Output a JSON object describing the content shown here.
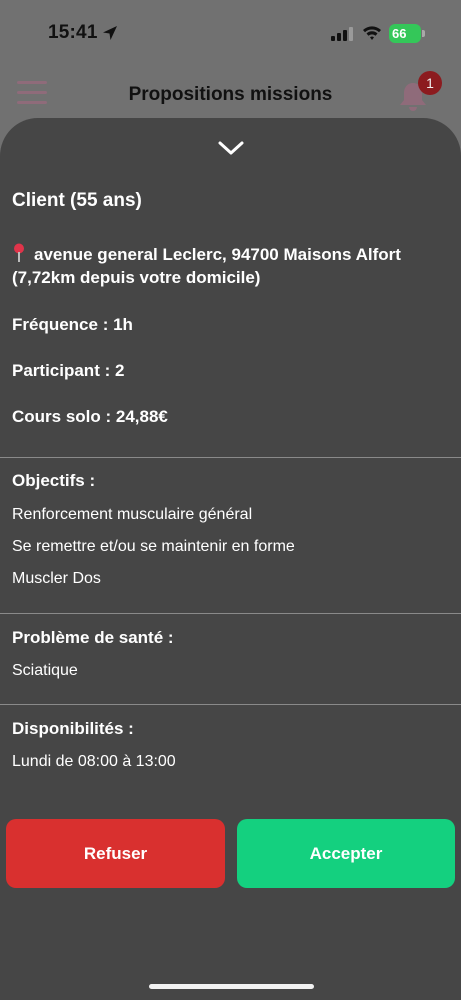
{
  "status_bar": {
    "time": "15:41",
    "battery": "66",
    "battery_color": "#34c759"
  },
  "header": {
    "title": "Propositions missions",
    "notification_count": "1",
    "icons": [
      "menu-icon",
      "bell-icon"
    ]
  },
  "sheet": {
    "client": "Client (55 ans)",
    "address_line1": "avenue general Leclerc, 94700 Maisons Alfort",
    "address_line2": "(7,72km depuis votre domicile)",
    "frequence": "Fréquence : 1h",
    "participant": "Participant : 2",
    "cours_solo": "Cours solo : 24,88€",
    "objectifs": {
      "title": "Objectifs :",
      "items": [
        "Renforcement musculaire général",
        "Se remettre et/ou se maintenir en forme",
        "Muscler Dos"
      ]
    },
    "sante": {
      "title": "Problème de santé :",
      "items": [
        "Sciatique"
      ]
    },
    "disponibilites": {
      "title": "Disponibilités :",
      "items": [
        "Lundi de 08:00 à 13:00"
      ]
    },
    "buttons": {
      "refuse": "Refuser",
      "accept": "Accepter"
    }
  },
  "colors": {
    "refuse": "#d9302f",
    "accept": "#14d07f",
    "sheet_bg": "#464646"
  }
}
